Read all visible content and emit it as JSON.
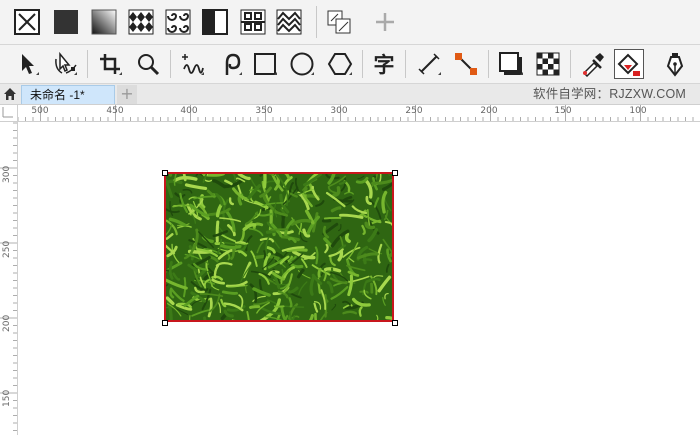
{
  "app": {
    "document_tab": "未命名 -1*",
    "site_label": "软件自学网：RJZXW.COM"
  },
  "fill_bar": {
    "buttons": [
      {
        "name": "no-fill-icon"
      },
      {
        "name": "uniform-fill-icon"
      },
      {
        "name": "fountain-fill-icon"
      },
      {
        "name": "vector-pattern-fill-icon"
      },
      {
        "name": "bitmap-pattern-fill-icon"
      },
      {
        "name": "two-color-pattern-fill-icon"
      },
      {
        "name": "texture-fill-icon"
      },
      {
        "name": "postscript-fill-icon"
      },
      {
        "name": "color-merge-icon"
      },
      {
        "name": "add-icon"
      }
    ]
  },
  "toolbox": {
    "tools": [
      {
        "name": "pick-tool-icon"
      },
      {
        "name": "shape-tool-icon"
      },
      {
        "name": "crop-tool-icon"
      },
      {
        "name": "zoom-tool-icon"
      },
      {
        "name": "freehand-tool-icon"
      },
      {
        "name": "artistic-media-tool-icon"
      },
      {
        "name": "rectangle-tool-icon"
      },
      {
        "name": "ellipse-tool-icon"
      },
      {
        "name": "polygon-tool-icon"
      },
      {
        "name": "text-tool-icon",
        "glyph": "字"
      },
      {
        "name": "parallel-dimension-tool-icon"
      },
      {
        "name": "connector-tool-icon"
      },
      {
        "name": "drop-shadow-tool-icon"
      },
      {
        "name": "transparency-tool-icon"
      },
      {
        "name": "eyedropper-tool-icon"
      },
      {
        "name": "interactive-fill-tool-icon"
      },
      {
        "name": "pen-nib-tool-icon"
      }
    ]
  },
  "rulers": {
    "horizontal_labels": [
      "500",
      "450",
      "400",
      "350",
      "300",
      "250",
      "200",
      "150",
      "100"
    ],
    "vertical_labels": [
      "300",
      "250",
      "200",
      "150"
    ]
  },
  "colors": {
    "selection_outline": "#c8161d",
    "tab_active": "#cfe6fb",
    "grass": "#3c7a17"
  }
}
